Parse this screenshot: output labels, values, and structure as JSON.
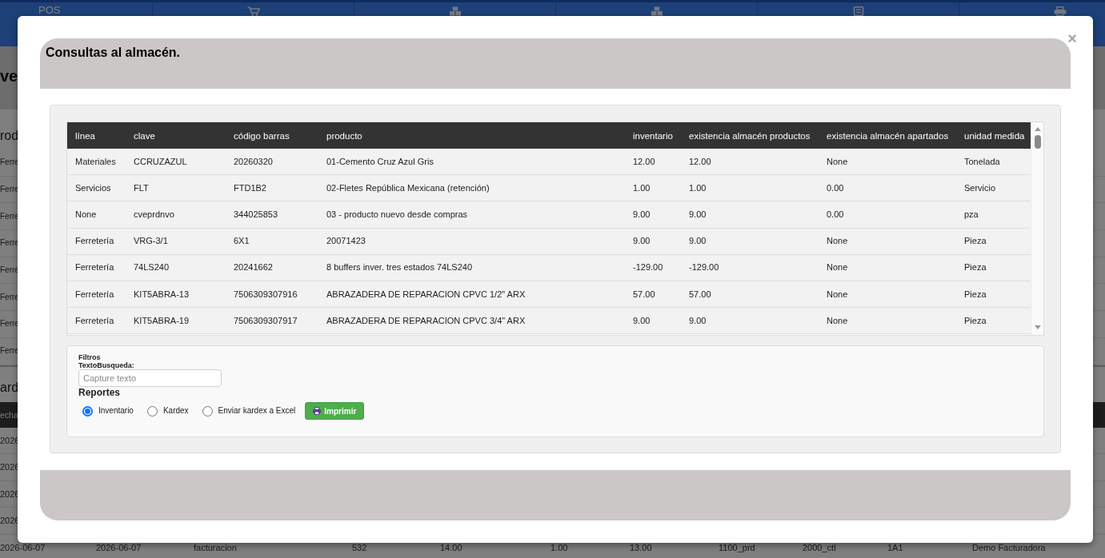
{
  "background_page": {
    "nav_bar": {
      "brand": "POS"
    },
    "page_title": "ve",
    "products_heading": "rod",
    "product_rows": [
      "Ferre",
      "Ferre",
      "Ferre",
      "Ferre",
      "Ferre",
      "Ferre",
      "Ferre",
      "Ferre"
    ],
    "kardex_heading": "ard",
    "kardex_columns": [
      "echa"
    ],
    "kardex_rows": [
      [
        "2026"
      ],
      [
        "2026"
      ],
      [
        "2026"
      ],
      [
        "2026"
      ],
      [
        "2026-06-07",
        "2026-06-07",
        "facturacion",
        "532",
        "14.00",
        "1.00",
        "13.00",
        "1100_prd",
        "2000_ctl",
        "1A1",
        "Demo Facturadora"
      ]
    ]
  },
  "dialog": {
    "title": "Consultas al almacén.",
    "close": "×",
    "table": {
      "columns": [
        "línea",
        "clave",
        "código barras",
        "producto",
        "inventario",
        "existencia almacén productos",
        "existencia almacén apartados",
        "unidad medida"
      ],
      "rows": [
        [
          "Materiales",
          "CCRUZAZUL",
          "20260320",
          "01-Cemento Cruz Azul Gris",
          "12.00",
          "12.00",
          "None",
          "Tonelada"
        ],
        [
          "Servicios",
          "FLT",
          "FTD1B2",
          "02-Fletes República Mexicana (retención)",
          "1.00",
          "1.00",
          "0.00",
          "Servicio"
        ],
        [
          "None",
          "cveprdnvo",
          "344025853",
          "03 - producto nuevo desde compras",
          "9.00",
          "9.00",
          "0.00",
          "pza"
        ],
        [
          "Ferretería",
          "VRG-3/1",
          "6X1",
          "20071423",
          "9.00",
          "9.00",
          "None",
          "Pieza"
        ],
        [
          "Ferretería",
          "74LS240",
          "20241662",
          "8 buffers inver. tres estados 74LS240",
          "-129.00",
          "-129.00",
          "None",
          "Pieza"
        ],
        [
          "Ferretería",
          "KIT5ABRA-13",
          "7506309307916",
          "ABRAZADERA DE REPARACION CPVC 1/2\" ARX",
          "57.00",
          "57.00",
          "None",
          "Pieza"
        ],
        [
          "Ferretería",
          "KIT5ABRA-19",
          "7506309307917",
          "ABRAZADERA DE REPARACION CPVC 3/4\" ARX",
          "9.00",
          "9.00",
          "None",
          "Pieza"
        ]
      ]
    },
    "filters": {
      "heading": "Filtros",
      "search_label": "TextoBusqueda:",
      "search": {
        "placeholder": "Capture texto"
      }
    },
    "reports": {
      "heading": "Reportes",
      "options": [
        {
          "label": "Inventario",
          "selected": true
        },
        {
          "label": "Kardex",
          "selected": false
        },
        {
          "label": "Enviar kardex a Excel",
          "selected": false
        }
      ],
      "print_button": "Imprimir"
    }
  }
}
